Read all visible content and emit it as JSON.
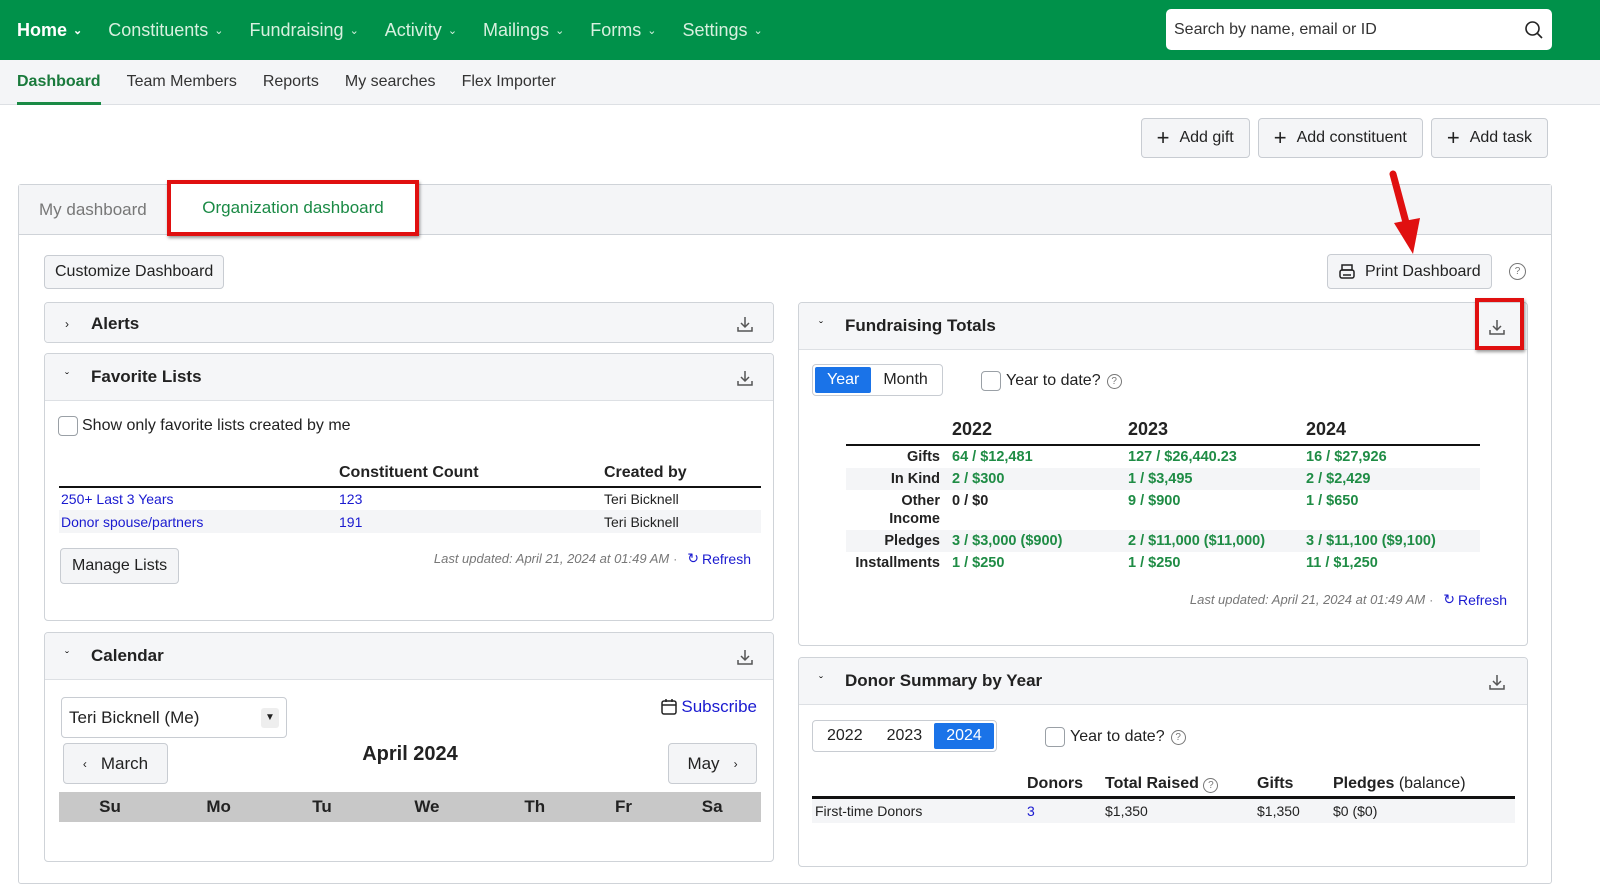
{
  "topnav": {
    "items": [
      {
        "label": "Home"
      },
      {
        "label": "Constituents"
      },
      {
        "label": "Fundraising"
      },
      {
        "label": "Activity"
      },
      {
        "label": "Mailings"
      },
      {
        "label": "Forms"
      },
      {
        "label": "Settings"
      }
    ],
    "search_placeholder": "Search by name, email or ID"
  },
  "subnav": {
    "items": [
      {
        "label": "Dashboard",
        "active": true
      },
      {
        "label": "Team Members"
      },
      {
        "label": "Reports"
      },
      {
        "label": "My searches"
      },
      {
        "label": "Flex Importer"
      }
    ]
  },
  "actions": {
    "add_gift": "Add gift",
    "add_constituent": "Add constituent",
    "add_task": "Add task"
  },
  "tabs": {
    "my_dashboard": "My dashboard",
    "org_dashboard": "Organization dashboard"
  },
  "customize_label": "Customize Dashboard",
  "print_label": "Print Dashboard",
  "alerts": {
    "title": "Alerts"
  },
  "favorite_lists": {
    "title": "Favorite Lists",
    "checkbox_label": "Show only favorite lists created by me",
    "columns": [
      "",
      "Constituent Count",
      "Created by"
    ],
    "rows": [
      {
        "name": "250+ Last 3 Years",
        "count": "123",
        "created_by": "Teri Bicknell"
      },
      {
        "name": "Donor spouse/partners",
        "count": "191",
        "created_by": "Teri Bicknell"
      }
    ],
    "manage_label": "Manage Lists",
    "last_updated": "Last updated: April 21, 2024 at 01:49 AM",
    "refresh_label": "Refresh"
  },
  "calendar": {
    "title": "Calendar",
    "user_select": "Teri Bicknell (Me)",
    "subscribe_label": "Subscribe",
    "prev_label": "March",
    "next_label": "May",
    "month_title": "April 2024",
    "weekdays": [
      "Su",
      "Mo",
      "Tu",
      "We",
      "Th",
      "Fr",
      "Sa"
    ]
  },
  "fundraising_totals": {
    "title": "Fundraising Totals",
    "toggle": [
      "Year",
      "Month"
    ],
    "active_toggle": "Year",
    "ytd_label": "Year to date?",
    "years": [
      "2022",
      "2023",
      "2024"
    ],
    "rows": [
      {
        "label": "Gifts",
        "values": [
          "64 / $12,481",
          "127 / $26,440.23",
          "16 / $27,926"
        ]
      },
      {
        "label": "In Kind",
        "values": [
          "2 / $300",
          "1 / $3,495",
          "2 / $2,429"
        ]
      },
      {
        "label": "Other Income",
        "values": [
          "0 / $0",
          "9 / $900",
          "1 / $650"
        ]
      },
      {
        "label": "Pledges",
        "values": [
          "3 / $3,000 ($900)",
          "2 / $11,000 ($11,000)",
          "3 / $11,100 ($9,100)"
        ]
      },
      {
        "label": "Installments",
        "values": [
          "1 / $250",
          "1 / $250",
          "11 / $1,250"
        ]
      }
    ],
    "last_updated": "Last updated: April 21, 2024 at 01:49 AM",
    "refresh_label": "Refresh"
  },
  "donor_summary": {
    "title": "Donor Summary by Year",
    "years": [
      "2022",
      "2023",
      "2024"
    ],
    "active_year": "2024",
    "ytd_label": "Year to date?",
    "columns": [
      "",
      "Donors",
      "Total Raised",
      "Gifts",
      "Pledges",
      "(balance)"
    ],
    "rows": [
      {
        "label": "First-time Donors",
        "donors": "3",
        "total_raised": "$1,350",
        "gifts": "$1,350",
        "pledges": "$0 ($0)"
      }
    ]
  }
}
